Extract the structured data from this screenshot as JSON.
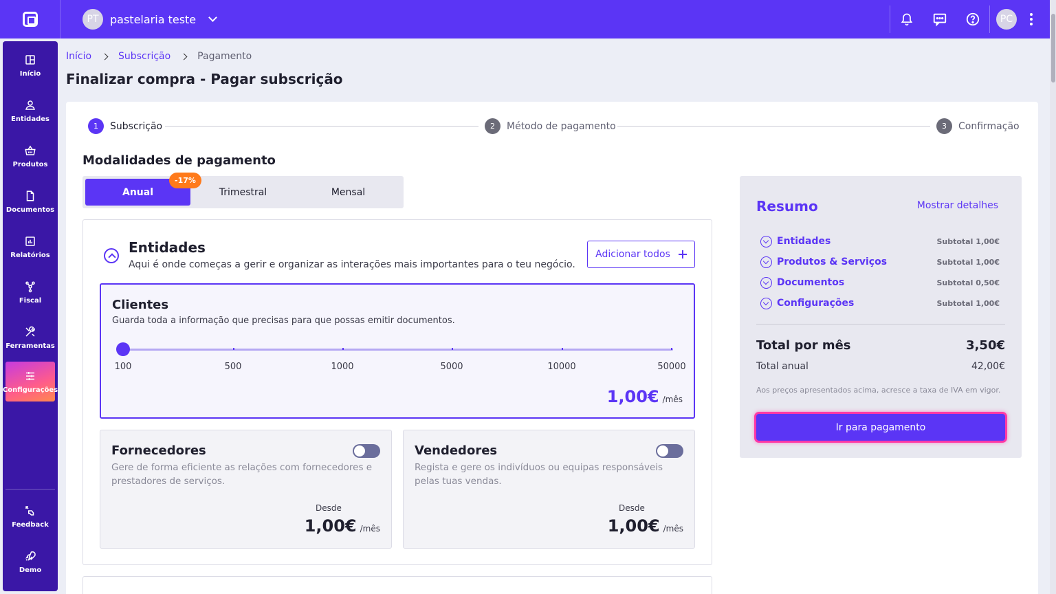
{
  "topbar": {
    "workspace_initials": "PT",
    "workspace_name": "pastelaria teste",
    "user_initials": "PC"
  },
  "sidebar": {
    "items": [
      {
        "label": "Início",
        "icon": "grid-icon"
      },
      {
        "label": "Entidades",
        "icon": "person-icon"
      },
      {
        "label": "Produtos",
        "icon": "basket-icon"
      },
      {
        "label": "Documentos",
        "icon": "document-icon"
      },
      {
        "label": "Relatórios",
        "icon": "chart-icon"
      },
      {
        "label": "Fiscal",
        "icon": "network-icon"
      },
      {
        "label": "Ferramentas",
        "icon": "tools-icon"
      },
      {
        "label": "Configurações",
        "icon": "sliders-icon"
      }
    ],
    "bottom": [
      {
        "label": "Feedback",
        "icon": "feedback-icon"
      },
      {
        "label": "Demo",
        "icon": "rocket-icon"
      }
    ]
  },
  "breadcrumb": {
    "home": "Início",
    "subscription": "Subscrição",
    "current": "Pagamento"
  },
  "page_title": "Finalizar compra - Pagar subscrição",
  "stepper": [
    {
      "num": "1",
      "label": "Subscrição"
    },
    {
      "num": "2",
      "label": "Método de pagamento"
    },
    {
      "num": "3",
      "label": "Confirmação"
    }
  ],
  "modalities": {
    "title": "Modalidades de pagamento",
    "options": [
      "Anual",
      "Trimestral",
      "Mensal"
    ],
    "discount": "-17%"
  },
  "entities": {
    "title": "Entidades",
    "description": "Aqui é onde começas a gerir e organizar as interações mais importantes para o teu negócio.",
    "add_all": "Adicionar todos",
    "clients": {
      "title": "Clientes",
      "description": "Guarda toda a informação que precisas para que possas emitir documentos.",
      "ticks": [
        "100",
        "500",
        "1000",
        "5000",
        "10000",
        "50000"
      ],
      "selected": "100",
      "price": "1,00€",
      "per": "/mês"
    },
    "suppliers": {
      "title": "Fornecedores",
      "description": "Gere de forma eficiente as relações com fornecedores e prestadores de serviços.",
      "from": "Desde",
      "price": "1,00€",
      "per": "/mês",
      "enabled": false
    },
    "sellers": {
      "title": "Vendedores",
      "description": "Regista e gere os indivíduos ou equipas responsáveis pelas tuas vendas.",
      "from": "Desde",
      "price": "1,00€",
      "per": "/mês",
      "enabled": false
    }
  },
  "summary": {
    "title": "Resumo",
    "details_link": "Mostrar detalhes",
    "rows": [
      {
        "label": "Entidades",
        "subtotal": "Subtotal 1,00€"
      },
      {
        "label": "Produtos & Serviços",
        "subtotal": "Subtotal 1,00€"
      },
      {
        "label": "Documentos",
        "subtotal": "Subtotal 0,50€"
      },
      {
        "label": "Configurações",
        "subtotal": "Subtotal 1,00€"
      }
    ],
    "total_label": "Total por mês",
    "total_value": "3,50€",
    "annual_label": "Total anual",
    "annual_value": "42,00€",
    "vat_note": "Aos preços apresentados acima, acresce a taxa de IVA em vigor.",
    "pay_button": "Ir para pagamento"
  },
  "colors": {
    "primary": "#5b35f5",
    "sidebar": "#3a17a6",
    "discount": "#ff7a1a",
    "focus_ring": "#ff3aa6"
  }
}
